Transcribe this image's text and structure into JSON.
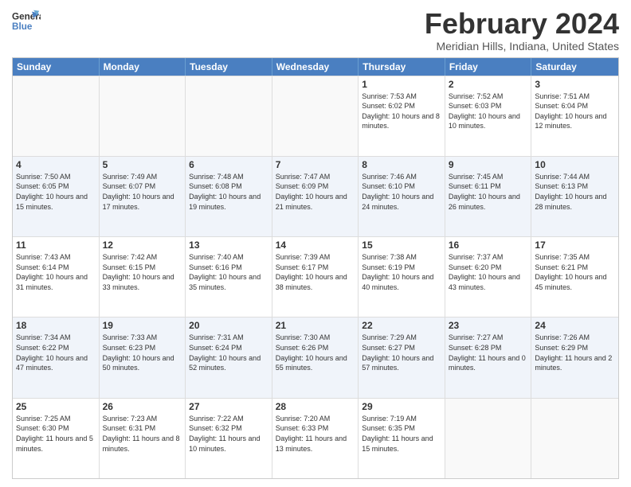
{
  "header": {
    "logo_general": "General",
    "logo_blue": "Blue",
    "title": "February 2024",
    "subtitle": "Meridian Hills, Indiana, United States"
  },
  "weekdays": [
    "Sunday",
    "Monday",
    "Tuesday",
    "Wednesday",
    "Thursday",
    "Friday",
    "Saturday"
  ],
  "rows": [
    [
      {
        "day": "",
        "info": "",
        "empty": true
      },
      {
        "day": "",
        "info": "",
        "empty": true
      },
      {
        "day": "",
        "info": "",
        "empty": true
      },
      {
        "day": "",
        "info": "",
        "empty": true
      },
      {
        "day": "1",
        "info": "Sunrise: 7:53 AM\nSunset: 6:02 PM\nDaylight: 10 hours\nand 8 minutes."
      },
      {
        "day": "2",
        "info": "Sunrise: 7:52 AM\nSunset: 6:03 PM\nDaylight: 10 hours\nand 10 minutes."
      },
      {
        "day": "3",
        "info": "Sunrise: 7:51 AM\nSunset: 6:04 PM\nDaylight: 10 hours\nand 12 minutes."
      }
    ],
    [
      {
        "day": "4",
        "info": "Sunrise: 7:50 AM\nSunset: 6:05 PM\nDaylight: 10 hours\nand 15 minutes."
      },
      {
        "day": "5",
        "info": "Sunrise: 7:49 AM\nSunset: 6:07 PM\nDaylight: 10 hours\nand 17 minutes."
      },
      {
        "day": "6",
        "info": "Sunrise: 7:48 AM\nSunset: 6:08 PM\nDaylight: 10 hours\nand 19 minutes."
      },
      {
        "day": "7",
        "info": "Sunrise: 7:47 AM\nSunset: 6:09 PM\nDaylight: 10 hours\nand 21 minutes."
      },
      {
        "day": "8",
        "info": "Sunrise: 7:46 AM\nSunset: 6:10 PM\nDaylight: 10 hours\nand 24 minutes."
      },
      {
        "day": "9",
        "info": "Sunrise: 7:45 AM\nSunset: 6:11 PM\nDaylight: 10 hours\nand 26 minutes."
      },
      {
        "day": "10",
        "info": "Sunrise: 7:44 AM\nSunset: 6:13 PM\nDaylight: 10 hours\nand 28 minutes."
      }
    ],
    [
      {
        "day": "11",
        "info": "Sunrise: 7:43 AM\nSunset: 6:14 PM\nDaylight: 10 hours\nand 31 minutes."
      },
      {
        "day": "12",
        "info": "Sunrise: 7:42 AM\nSunset: 6:15 PM\nDaylight: 10 hours\nand 33 minutes."
      },
      {
        "day": "13",
        "info": "Sunrise: 7:40 AM\nSunset: 6:16 PM\nDaylight: 10 hours\nand 35 minutes."
      },
      {
        "day": "14",
        "info": "Sunrise: 7:39 AM\nSunset: 6:17 PM\nDaylight: 10 hours\nand 38 minutes."
      },
      {
        "day": "15",
        "info": "Sunrise: 7:38 AM\nSunset: 6:19 PM\nDaylight: 10 hours\nand 40 minutes."
      },
      {
        "day": "16",
        "info": "Sunrise: 7:37 AM\nSunset: 6:20 PM\nDaylight: 10 hours\nand 43 minutes."
      },
      {
        "day": "17",
        "info": "Sunrise: 7:35 AM\nSunset: 6:21 PM\nDaylight: 10 hours\nand 45 minutes."
      }
    ],
    [
      {
        "day": "18",
        "info": "Sunrise: 7:34 AM\nSunset: 6:22 PM\nDaylight: 10 hours\nand 47 minutes."
      },
      {
        "day": "19",
        "info": "Sunrise: 7:33 AM\nSunset: 6:23 PM\nDaylight: 10 hours\nand 50 minutes."
      },
      {
        "day": "20",
        "info": "Sunrise: 7:31 AM\nSunset: 6:24 PM\nDaylight: 10 hours\nand 52 minutes."
      },
      {
        "day": "21",
        "info": "Sunrise: 7:30 AM\nSunset: 6:26 PM\nDaylight: 10 hours\nand 55 minutes."
      },
      {
        "day": "22",
        "info": "Sunrise: 7:29 AM\nSunset: 6:27 PM\nDaylight: 10 hours\nand 57 minutes."
      },
      {
        "day": "23",
        "info": "Sunrise: 7:27 AM\nSunset: 6:28 PM\nDaylight: 11 hours\nand 0 minutes."
      },
      {
        "day": "24",
        "info": "Sunrise: 7:26 AM\nSunset: 6:29 PM\nDaylight: 11 hours\nand 2 minutes."
      }
    ],
    [
      {
        "day": "25",
        "info": "Sunrise: 7:25 AM\nSunset: 6:30 PM\nDaylight: 11 hours\nand 5 minutes."
      },
      {
        "day": "26",
        "info": "Sunrise: 7:23 AM\nSunset: 6:31 PM\nDaylight: 11 hours\nand 8 minutes."
      },
      {
        "day": "27",
        "info": "Sunrise: 7:22 AM\nSunset: 6:32 PM\nDaylight: 11 hours\nand 10 minutes."
      },
      {
        "day": "28",
        "info": "Sunrise: 7:20 AM\nSunset: 6:33 PM\nDaylight: 11 hours\nand 13 minutes."
      },
      {
        "day": "29",
        "info": "Sunrise: 7:19 AM\nSunset: 6:35 PM\nDaylight: 11 hours\nand 15 minutes."
      },
      {
        "day": "",
        "info": "",
        "empty": true
      },
      {
        "day": "",
        "info": "",
        "empty": true
      }
    ]
  ]
}
